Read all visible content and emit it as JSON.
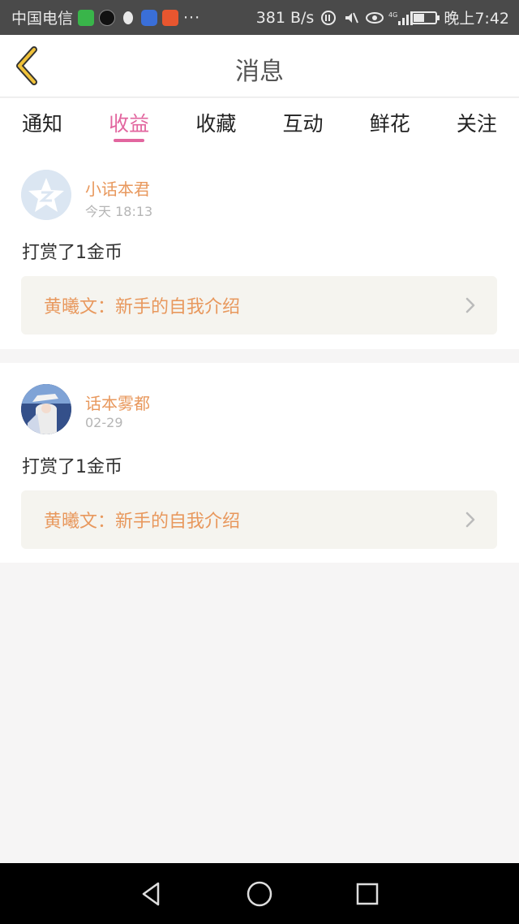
{
  "status_bar": {
    "carrier": "中国电信",
    "dots": "···",
    "speed": "381 B/s",
    "signal_label": "4G",
    "time": "晚上7:42",
    "battery_level": 0.5
  },
  "header": {
    "title": "消息"
  },
  "tabs": [
    {
      "label": "通知"
    },
    {
      "label": "收益"
    },
    {
      "label": "收藏"
    },
    {
      "label": "互动"
    },
    {
      "label": "鲜花"
    },
    {
      "label": "关注"
    }
  ],
  "active_tab": "收益",
  "messages": [
    {
      "user": "小话本君",
      "time": "今天 18:13",
      "action": "打赏了1金币",
      "link": "黄曦文：新手的自我介绍"
    },
    {
      "user": "话本雾都",
      "time": "02-29",
      "action": "打赏了1金币",
      "link": "黄曦文：新手的自我介绍"
    }
  ],
  "colors": {
    "accent_pink": "#e2669f",
    "username_orange": "#e8985d",
    "back_arrow_yellow": "#f0c23a"
  }
}
